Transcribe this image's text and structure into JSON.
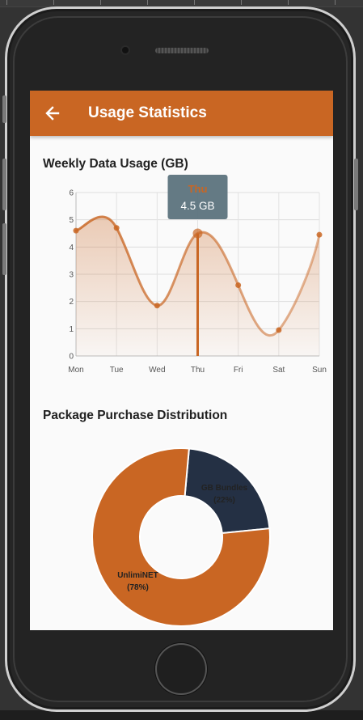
{
  "app": {
    "title": "Usage Statistics",
    "accent_color": "#c96623",
    "back_icon": "arrow-back-icon"
  },
  "weekly_section": {
    "title": "Weekly Data Usage (GB)"
  },
  "distribution_section": {
    "title": "Package Purchase Distribution"
  },
  "tooltip": {
    "day": "Thu",
    "value_text": "4.5 GB"
  },
  "chart_data": [
    {
      "type": "line",
      "x": [
        "Mon",
        "Tue",
        "Wed",
        "Thu",
        "Fri",
        "Sat",
        "Sun"
      ],
      "series": [
        {
          "values": [
            4.6,
            4.7,
            1.85,
            4.5,
            2.6,
            0.95,
            4.45
          ],
          "color": "#c96623"
        }
      ],
      "ylim": [
        0,
        6
      ],
      "yticks": [
        0,
        1,
        2,
        3,
        4,
        5,
        6
      ],
      "grid": true,
      "fill": "area-gradient",
      "highlighted_index": 3
    },
    {
      "type": "pie",
      "style": "donut",
      "slices": [
        {
          "label": "GB Bundles",
          "percent_label": "(22%)",
          "value": 22,
          "color": "#243044"
        },
        {
          "label": "UnlimiNET",
          "percent_label": "(78%)",
          "value": 78,
          "color": "#c96623"
        }
      ]
    }
  ]
}
